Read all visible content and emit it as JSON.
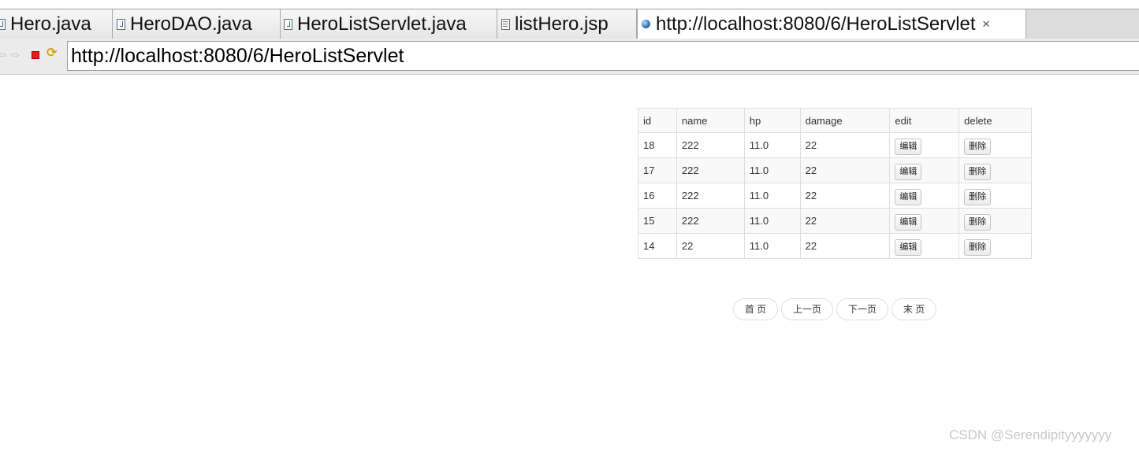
{
  "tabs": [
    {
      "label": "Hero.java",
      "icon": "java-file-icon"
    },
    {
      "label": "HeroDAO.java",
      "icon": "java-file-icon"
    },
    {
      "label": "HeroListServlet.java",
      "icon": "java-file-icon"
    },
    {
      "label": "listHero.jsp",
      "icon": "jsp-file-icon"
    },
    {
      "label": "http://localhost:8080/6/HeroListServlet",
      "icon": "globe-icon",
      "active": true,
      "close_glyph": "✕"
    }
  ],
  "toolbar": {
    "back_glyph": "⇦",
    "forward_glyph": "⇨",
    "refresh_glyph": "⟳",
    "url": "http://localhost:8080/6/HeroListServlet"
  },
  "table": {
    "headers": [
      "id",
      "name",
      "hp",
      "damage",
      "edit",
      "delete"
    ],
    "rows": [
      {
        "id": "18",
        "name": "222",
        "hp": "11.0",
        "damage": "22",
        "edit": "编辑",
        "delete": "删除"
      },
      {
        "id": "17",
        "name": "222",
        "hp": "11.0",
        "damage": "22",
        "edit": "编辑",
        "delete": "删除"
      },
      {
        "id": "16",
        "name": "222",
        "hp": "11.0",
        "damage": "22",
        "edit": "编辑",
        "delete": "删除"
      },
      {
        "id": "15",
        "name": "222",
        "hp": "11.0",
        "damage": "22",
        "edit": "编辑",
        "delete": "删除"
      },
      {
        "id": "14",
        "name": "22",
        "hp": "11.0",
        "damage": "22",
        "edit": "编辑",
        "delete": "删除"
      }
    ]
  },
  "pagination": {
    "first": "首 页",
    "prev": "上一页",
    "next": "下一页",
    "last": "末 页"
  },
  "watermark": "CSDN @Serendipityyyyyyy",
  "colors": {
    "stop_icon": "#e0201c",
    "refresh_icon": "#d4a200",
    "table_border": "#dddddd",
    "row_stripe": "#f9f9f9"
  }
}
